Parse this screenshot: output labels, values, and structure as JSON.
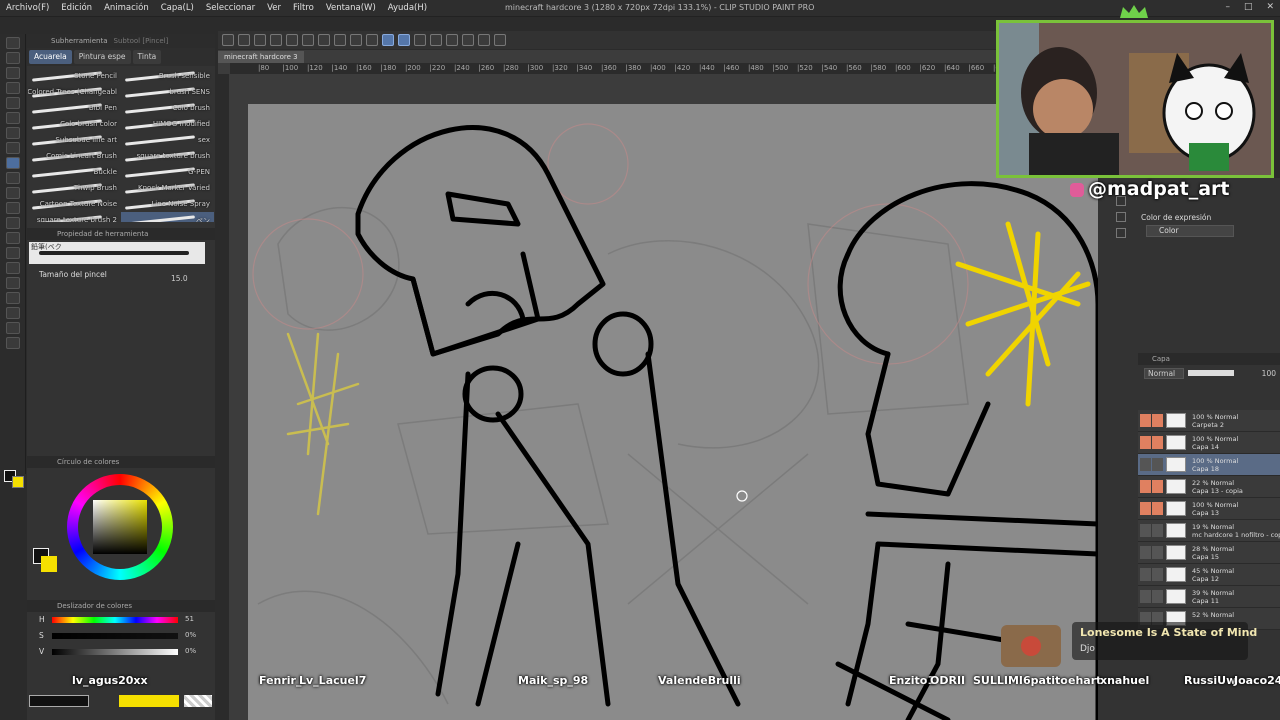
{
  "menu": [
    "Archivo(F)",
    "Edición",
    "Animación",
    "Capa(L)",
    "Seleccionar",
    "Ver",
    "Filtro",
    "Ventana(W)",
    "Ayuda(H)"
  ],
  "window": {
    "title": "minecraft hardcore 3 (1280 x 720px 72dpi 133.1%) - CLIP STUDIO PAINT PRO"
  },
  "document_tab": "minecraft hardcore 3",
  "ruler_ticks": [
    "|80",
    "|100",
    "|120",
    "|140",
    "|160",
    "|180",
    "|200",
    "|220",
    "|240",
    "|260",
    "|280",
    "|300",
    "|320",
    "|340",
    "|360",
    "|380",
    "|400",
    "|420",
    "|440",
    "|460",
    "|480",
    "|500",
    "|520",
    "|540",
    "|560",
    "|580",
    "|600",
    "|620",
    "|640",
    "|660",
    "|680",
    "|700",
    "|720",
    "|740",
    "|760",
    "|780",
    "|800"
  ],
  "left_panel": {
    "sub_tool_header": "Subherramienta",
    "sub_tool_header2": "Subtool [Pincel]",
    "tabs": [
      "Acuarela",
      "Pintura espe",
      "Tinta"
    ],
    "brushes": [
      {
        "name": "Stone Pencil"
      },
      {
        "name": "Brush sensible"
      },
      {
        "name": "Colored Trees (Changeabl"
      },
      {
        "name": "brush SENS"
      },
      {
        "name": "Bibi Pen"
      },
      {
        "name": "Colo brush"
      },
      {
        "name": "Colo brush color"
      },
      {
        "name": "HIMOG modified"
      },
      {
        "name": "Subsubue line art"
      },
      {
        "name": "sex"
      },
      {
        "name": "Comic Lineart Brush"
      },
      {
        "name": "square texture brush"
      },
      {
        "name": "Buckle"
      },
      {
        "name": "G-PEN"
      },
      {
        "name": "Thwip Brush"
      },
      {
        "name": "Knock Marker Varied"
      },
      {
        "name": "Cartoon Texture Noise"
      },
      {
        "name": "Line Noise Spray"
      },
      {
        "name": "square texture brush 2"
      },
      {
        "name": "ペン"
      }
    ],
    "tool_property_header": "Propiedad de herramienta",
    "brush_name": "鉛筆(ベク",
    "brush_size_label": "Tamaño del pincel",
    "brush_size_value": "15.0",
    "color_circle_header": "Círculo de colores",
    "color_sliders_header": "Deslizador de colores",
    "sliders": [
      {
        "key": "H",
        "value": "51"
      },
      {
        "key": "S",
        "value": "0%"
      },
      {
        "key": "V",
        "value": "0%"
      }
    ]
  },
  "right_panel": {
    "expression_label": "Color de expresión",
    "expression_value": "Color",
    "layer_header": "Capa",
    "blend_mode": "Normal",
    "opacity": "100",
    "layers": [
      {
        "opacity": "100 % Normal",
        "name": "Carpeta 2",
        "vis": true,
        "lock": true,
        "sel": false
      },
      {
        "opacity": "100 % Normal",
        "name": "Capa 14",
        "vis": true,
        "lock": true,
        "sel": false
      },
      {
        "opacity": "100 % Normal",
        "name": "Capa 18",
        "vis": false,
        "lock": false,
        "sel": true
      },
      {
        "opacity": "22 % Normal",
        "name": "Capa 13 - copia",
        "vis": true,
        "lock": true,
        "sel": false
      },
      {
        "opacity": "100 % Normal",
        "name": "Capa 13",
        "vis": true,
        "lock": true,
        "sel": false
      },
      {
        "opacity": "19 % Normal",
        "name": "mc hardcore 1 nofiltro - copia",
        "vis": false,
        "lock": false,
        "sel": false
      },
      {
        "opacity": "28 % Normal",
        "name": "Capa 15",
        "vis": false,
        "lock": false,
        "sel": false
      },
      {
        "opacity": "45 % Normal",
        "name": "Capa 12",
        "vis": false,
        "lock": false,
        "sel": false
      },
      {
        "opacity": "39 % Normal",
        "name": "Capa 11",
        "vis": false,
        "lock": false,
        "sel": false
      },
      {
        "opacity": "52 % Normal",
        "name": "",
        "vis": false,
        "lock": false,
        "sel": false
      }
    ]
  },
  "overlay": {
    "handle": "@madpat_art",
    "song_title": "Lonesome Is A State of Mind",
    "song_artist": "Djo",
    "chatters": [
      {
        "name": "lv_agus20xx"
      },
      {
        "name": "Fenrir_"
      },
      {
        "name": "Lv_Lacuel7"
      },
      {
        "name": "Maik_sp_98"
      },
      {
        "name": "ValendeBrulli"
      },
      {
        "name": "Enzito1"
      },
      {
        "name": "ODRII"
      },
      {
        "name": "SULLIMI"
      },
      {
        "name": "6patito"
      },
      {
        "name": "ehart"
      },
      {
        "name": "xnahuel"
      },
      {
        "name": "RussiUw"
      },
      {
        "name": "Joaco24"
      }
    ]
  },
  "colors": {
    "fg": "#111111",
    "bg": "#f5e000",
    "accent": "#4b5f7e",
    "frame": "#7ac23a"
  }
}
